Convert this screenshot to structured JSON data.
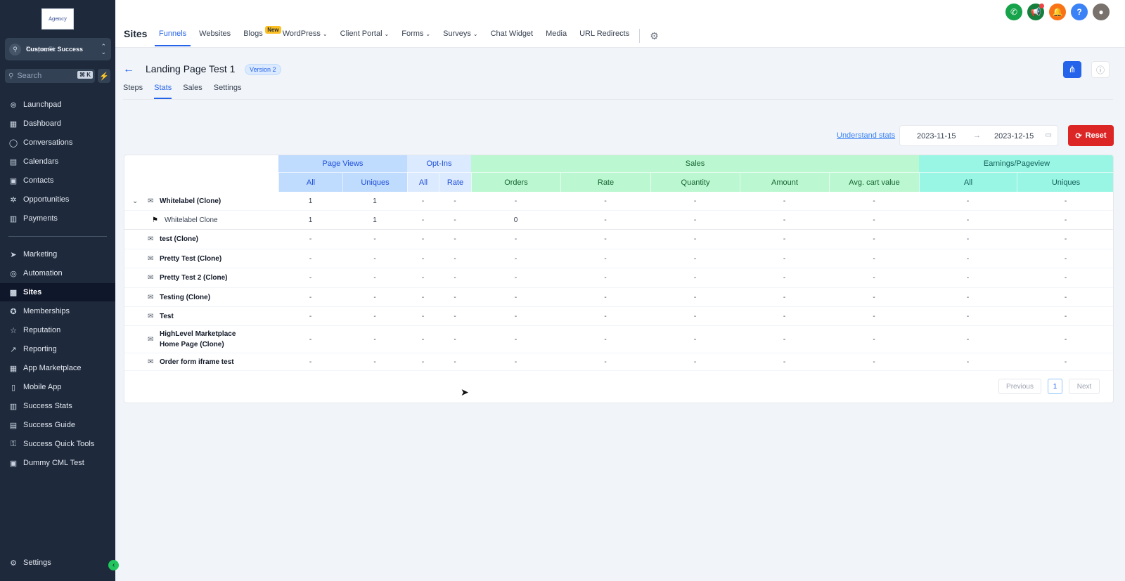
{
  "sidebar": {
    "logo_text": "Agency",
    "account_name": "Customer Success",
    "account_location": "Tampa, FL",
    "search_placeholder": "Search",
    "search_shortcut": "⌘ K",
    "items_top": [
      {
        "label": "Launchpad",
        "icon": "rocket-icon"
      },
      {
        "label": "Dashboard",
        "icon": "grid-icon"
      },
      {
        "label": "Conversations",
        "icon": "chat-icon"
      },
      {
        "label": "Calendars",
        "icon": "calendar-icon"
      },
      {
        "label": "Contacts",
        "icon": "contacts-icon"
      },
      {
        "label": "Opportunities",
        "icon": "opportunities-icon"
      },
      {
        "label": "Payments",
        "icon": "payments-icon"
      }
    ],
    "items_bottom": [
      {
        "label": "Marketing",
        "icon": "send-icon"
      },
      {
        "label": "Automation",
        "icon": "automation-icon"
      },
      {
        "label": "Sites",
        "icon": "sites-icon"
      },
      {
        "label": "Memberships",
        "icon": "award-icon"
      },
      {
        "label": "Reputation",
        "icon": "star-icon"
      },
      {
        "label": "Reporting",
        "icon": "trend-icon"
      },
      {
        "label": "App Marketplace",
        "icon": "apps-icon"
      },
      {
        "label": "Mobile App",
        "icon": "mobile-icon"
      },
      {
        "label": "Success Stats",
        "icon": "stats-icon"
      },
      {
        "label": "Success Guide",
        "icon": "book-icon"
      },
      {
        "label": "Success Quick Tools",
        "icon": "key-icon"
      },
      {
        "label": "Dummy CML Test",
        "icon": "window-icon"
      }
    ],
    "active": "Sites",
    "settings_label": "Settings"
  },
  "topbar": {
    "section": "Sites",
    "tabs": [
      {
        "label": "Funnels",
        "active": true
      },
      {
        "label": "Websites"
      },
      {
        "label": "Blogs",
        "badge": "New"
      },
      {
        "label": "WordPress",
        "dropdown": true
      },
      {
        "label": "Client Portal",
        "dropdown": true
      },
      {
        "label": "Forms",
        "dropdown": true
      },
      {
        "label": "Surveys",
        "dropdown": true
      },
      {
        "label": "Chat Widget"
      },
      {
        "label": "Media"
      },
      {
        "label": "URL Redirects"
      }
    ],
    "icons": [
      {
        "name": "phone-icon",
        "color": "#16a34a"
      },
      {
        "name": "megaphone-icon",
        "color": "#15803d"
      },
      {
        "name": "bell-icon",
        "color": "#f97316"
      },
      {
        "name": "help-icon",
        "color": "#3b82f6"
      }
    ]
  },
  "page": {
    "title": "Landing Page Test 1",
    "version": "Version 2",
    "subtabs": [
      "Steps",
      "Stats",
      "Sales",
      "Settings"
    ],
    "active_subtab": "Stats"
  },
  "stats": {
    "understand_link": "Understand stats",
    "date_from": "2023-11-15",
    "date_to": "2023-12-15",
    "reset_label": "Reset"
  },
  "table": {
    "groups": [
      "Page Views",
      "Opt-Ins",
      "Sales",
      "Earnings/Pageview"
    ],
    "subheaders": [
      "All",
      "Uniques",
      "All",
      "Rate",
      "Orders",
      "Rate",
      "Quantity",
      "Amount",
      "Avg. cart value",
      "All",
      "Uniques"
    ],
    "rows": [
      {
        "name": "Whitelabel (Clone)",
        "values": [
          "1",
          "1",
          "-",
          "-",
          "-",
          "-",
          "-",
          "-",
          "-",
          "-",
          "-"
        ]
      },
      {
        "name": "Whitelabel Clone",
        "values": [
          "1",
          "1",
          "-",
          "-",
          "0",
          "-",
          "-",
          "-",
          "-",
          "-",
          "-"
        ]
      },
      {
        "name": "test (Clone)",
        "values": [
          "-",
          "-",
          "-",
          "-",
          "-",
          "-",
          "-",
          "-",
          "-",
          "-",
          "-"
        ]
      },
      {
        "name": "Pretty Test (Clone)",
        "values": [
          "-",
          "-",
          "-",
          "-",
          "-",
          "-",
          "-",
          "-",
          "-",
          "-",
          "-"
        ]
      },
      {
        "name": "Pretty Test 2 (Clone)",
        "values": [
          "-",
          "-",
          "-",
          "-",
          "-",
          "-",
          "-",
          "-",
          "-",
          "-",
          "-"
        ]
      },
      {
        "name": "Testing (Clone)",
        "values": [
          "-",
          "-",
          "-",
          "-",
          "-",
          "-",
          "-",
          "-",
          "-",
          "-",
          "-"
        ]
      },
      {
        "name": "Test",
        "values": [
          "-",
          "-",
          "-",
          "-",
          "-",
          "-",
          "-",
          "-",
          "-",
          "-",
          "-"
        ]
      },
      {
        "name": "HighLevel Marketplace Home Page (Clone)",
        "values": [
          "-",
          "-",
          "-",
          "-",
          "-",
          "-",
          "-",
          "-",
          "-",
          "-",
          "-"
        ]
      },
      {
        "name": "Order form iframe test",
        "values": [
          "-",
          "-",
          "-",
          "-",
          "-",
          "-",
          "-",
          "-",
          "-",
          "-",
          "-"
        ]
      }
    ],
    "pagination": {
      "previous": "Previous",
      "page": "1",
      "next": "Next"
    }
  }
}
